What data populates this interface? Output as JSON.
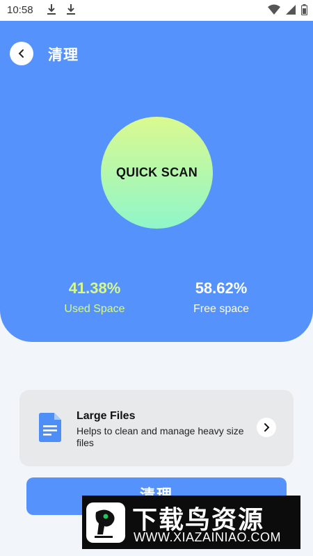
{
  "status_bar": {
    "time": "10:58",
    "icons": [
      "download-icon",
      "download-icon",
      "wifi-icon",
      "signal-icon",
      "battery-icon"
    ]
  },
  "header": {
    "title": "清理",
    "back_icon": "chevron-left-icon"
  },
  "scan": {
    "label": "QUICK SCAN"
  },
  "storage": {
    "used_value": "41.38%",
    "used_label": "Used Space",
    "free_value": "58.62%",
    "free_label": "Free space"
  },
  "large_files": {
    "title": "Large Files",
    "description": "Helps to clean and manage heavy size files",
    "icon": "document-icon",
    "action_icon": "chevron-right-icon"
  },
  "clean_button": {
    "label": "清理"
  },
  "watermark": {
    "title": "下载鸟资源",
    "url": "WWW.XIAZAINIAO.COM"
  },
  "colors": {
    "primary": "#5592fb",
    "used_accent": "#d6f98e",
    "circle_top": "#dbf98f",
    "circle_bottom": "#8ff6c9"
  }
}
